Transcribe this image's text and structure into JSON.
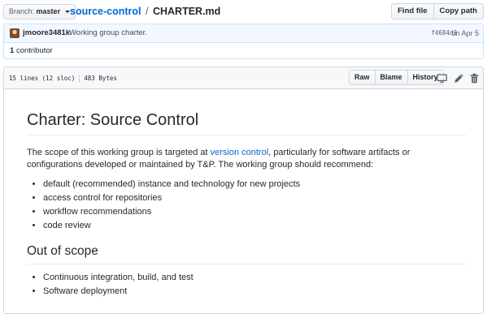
{
  "topbar": {
    "branch_label": "Branch:",
    "branch_value": "master",
    "repo": "source-control",
    "separator": "/",
    "file": "CHARTER.md",
    "find_file": "Find file",
    "copy_path": "Copy path"
  },
  "commit": {
    "author": "jmoore3481k",
    "message": "Working group charter.",
    "sha": "f4684d3",
    "date": "on Apr 5",
    "contributors_count": "1",
    "contributors_label": "contributor"
  },
  "file_header": {
    "lines": "15 lines (12 sloc)",
    "size": "483 Bytes",
    "raw": "Raw",
    "blame": "Blame",
    "history": "History",
    "icons": [
      "desktop-icon",
      "pencil-icon",
      "trash-icon"
    ]
  },
  "markdown": {
    "h1": "Charter: Source Control",
    "para_before": "The scope of this working group is targeted at ",
    "para_link": "version control",
    "para_after": ", particularly for software artifacts or configurations developed or maintained by T&P. The working group should recommend:",
    "list1": [
      "default (recommended) instance and technology for new projects",
      "access control for repositories",
      "workflow recommendations",
      "code review"
    ],
    "h2": "Out of scope",
    "list2": [
      "Continuous integration, build, and test",
      "Software deployment"
    ]
  },
  "colors": {
    "link": "#0366d6",
    "commit_bg": "#f1f8ff",
    "border": "#d1d5da"
  }
}
